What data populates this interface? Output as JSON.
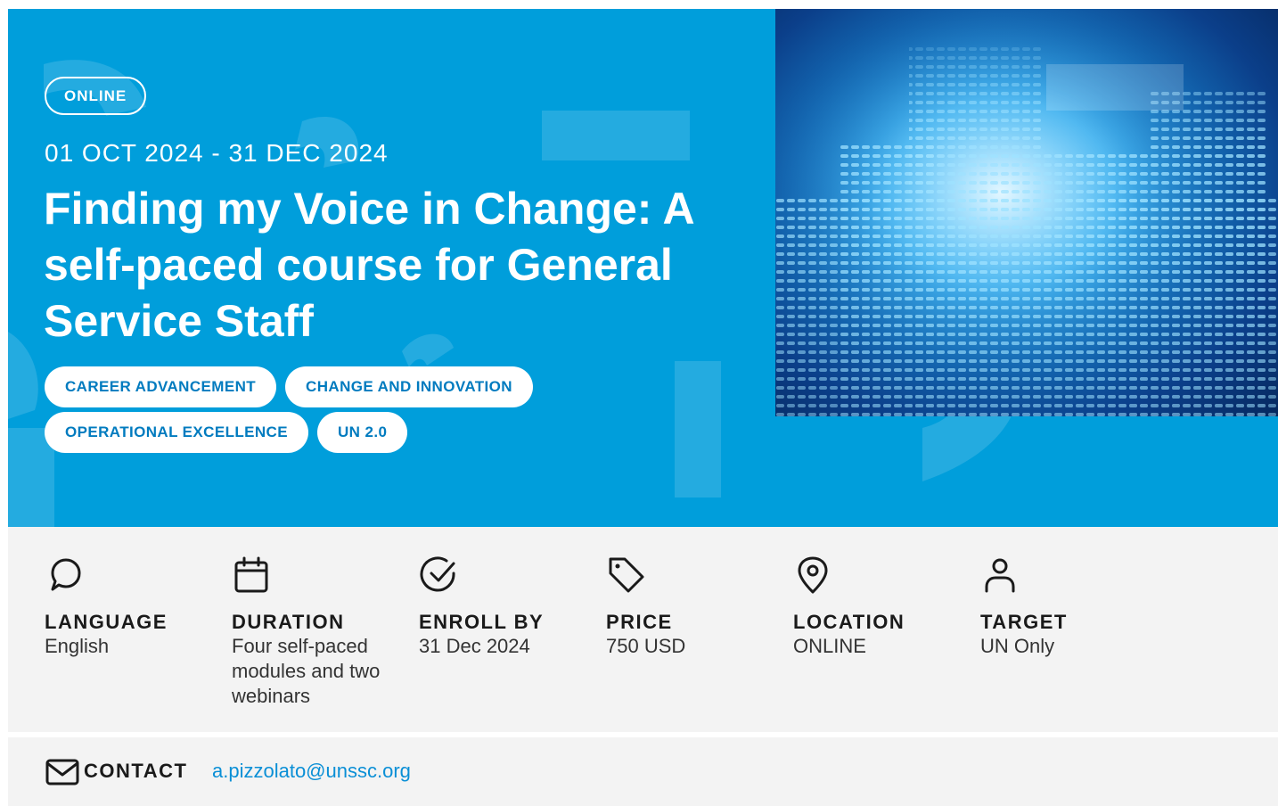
{
  "hero": {
    "badge": "ONLINE",
    "dates": "01 OCT 2024 - 31 DEC 2024",
    "title": "Finding my Voice in Change: A self-paced course for General Service Staff",
    "tags": [
      "CAREER ADVANCEMENT",
      "CHANGE AND INNOVATION",
      "OPERATIONAL EXCELLENCE",
      "UN 2.0"
    ],
    "background_color": "#009edb",
    "image_icon": "sound-wave-image"
  },
  "facts": [
    {
      "icon": "chat-bubble-icon",
      "label": "LANGUAGE",
      "value": "English"
    },
    {
      "icon": "calendar-icon",
      "label": "DURATION",
      "value": "Four self-paced modules and two webinars"
    },
    {
      "icon": "check-circle-icon",
      "label": "ENROLL BY",
      "value": "31 Dec 2024"
    },
    {
      "icon": "price-tag-icon",
      "label": "PRICE",
      "value": "750 USD"
    },
    {
      "icon": "location-pin-icon",
      "label": "LOCATION",
      "value": "ONLINE"
    },
    {
      "icon": "person-icon",
      "label": "TARGET",
      "value": "UN Only"
    }
  ],
  "contact": {
    "icon": "envelope-icon",
    "label": "CONTACT",
    "email": "a.pizzolato@unssc.org"
  },
  "colors": {
    "accent_blue": "#009edb",
    "link_blue": "#0a8fd6",
    "tag_text": "#007bbf",
    "panel_gray": "#f3f3f3"
  }
}
